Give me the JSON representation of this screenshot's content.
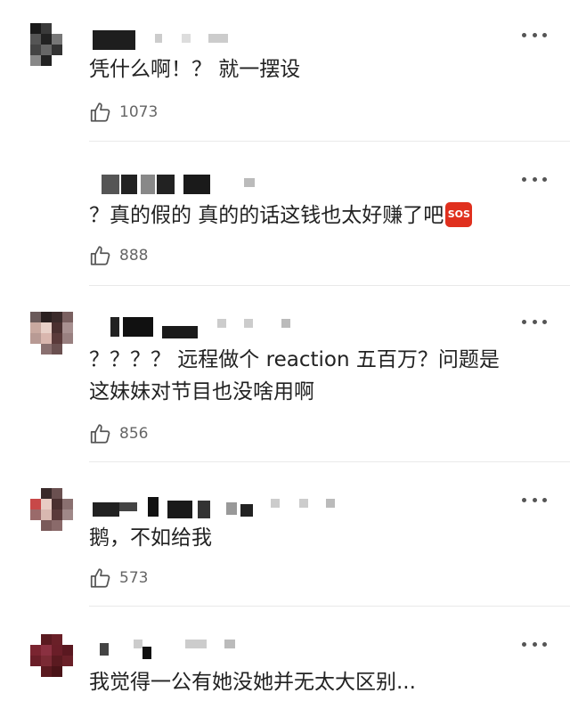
{
  "comments": [
    {
      "text": "凭什么啊！？ 就一摆设",
      "likes": "1073",
      "emoji": ""
    },
    {
      "text": "？真的假的 真的的话这钱也太好赚了吧",
      "likes": "888",
      "emoji": "SOS"
    },
    {
      "text": "？？？？ 远程做个 reaction 五百万？问题是\n这妹妹对节目也没啥用啊",
      "likes": "856",
      "emoji": ""
    },
    {
      "text": "鹅，不如给我",
      "likes": "573",
      "emoji": ""
    },
    {
      "text": "我觉得一公有她没她并无太大区别...",
      "likes": "",
      "emoji": ""
    }
  ],
  "icons": {
    "like": "thumbs-up-icon",
    "more": "more-dots-icon",
    "reply_emoji": "sos-emoji"
  },
  "colors": {
    "text": "#222222",
    "meta": "#666666",
    "divider": "#e9e9e9",
    "sos": "#e0301e"
  }
}
